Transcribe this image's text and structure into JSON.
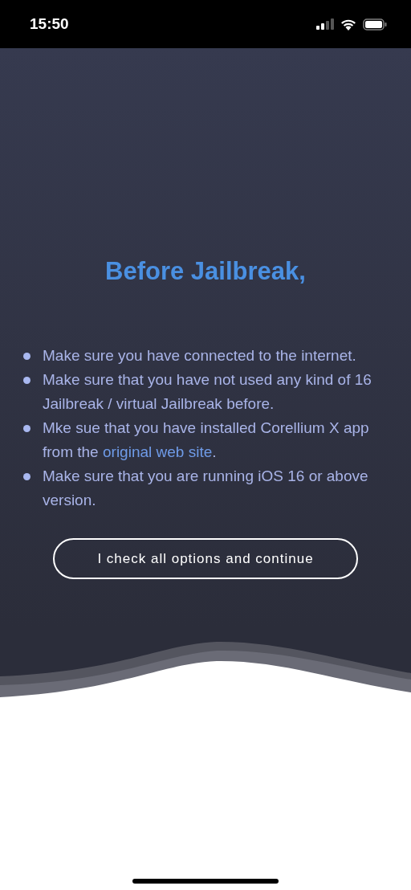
{
  "status_bar": {
    "time": "15:50"
  },
  "title": "Before Jailbreak,",
  "checklist": [
    {
      "text": "Make sure you have connected to the internet."
    },
    {
      "text": "Make sure that you have not used any kind of 16 Jailbreak / virtual Jailbreak before."
    },
    {
      "text": "Mke sue that you have installed Corellium X app from the ",
      "link": "original web site",
      "text_after": "."
    },
    {
      "text": "Make sure that you are running iOS 16 or above version."
    }
  ],
  "continue_button": "I check all options and continue"
}
